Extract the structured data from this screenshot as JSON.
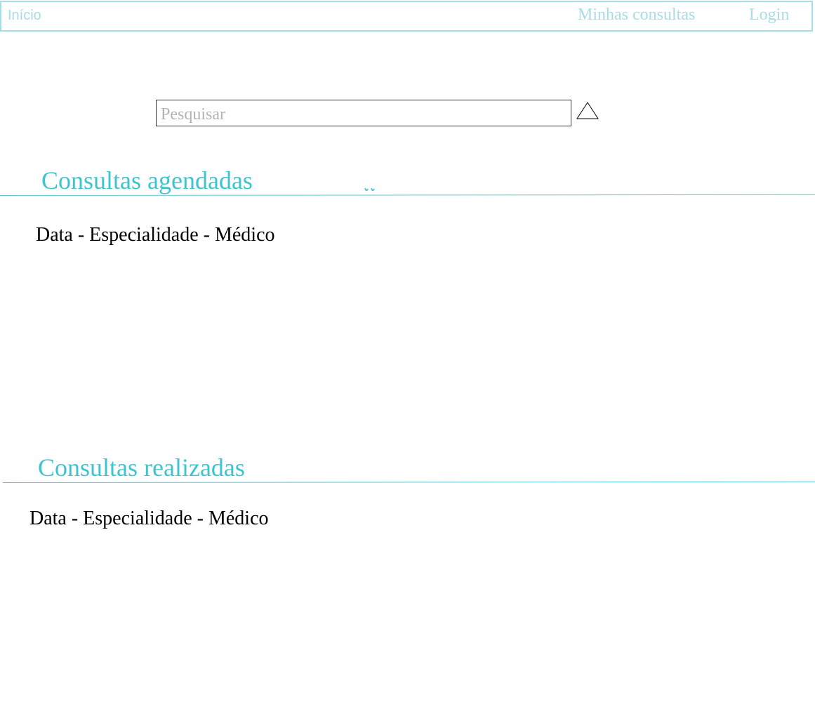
{
  "nav": {
    "home_label": "Início",
    "consultas_label": "Minhas consultas",
    "login_label": "Login"
  },
  "search": {
    "placeholder": "Pesquisar",
    "value": "",
    "button_icon": "triangle-icon"
  },
  "sections": {
    "agendadas": {
      "title": "Consultas agendadas",
      "items": [
        "Data - Especialidade - Médico"
      ]
    },
    "realizadas": {
      "title": "Consultas realizadas",
      "items": [
        "Data - Especialidade - Médico"
      ]
    }
  },
  "colors": {
    "nav_border": "#a7dde8",
    "nav_text": "#a9dde6",
    "section_title": "#3cc4cf",
    "divider": "#56c8d0"
  }
}
